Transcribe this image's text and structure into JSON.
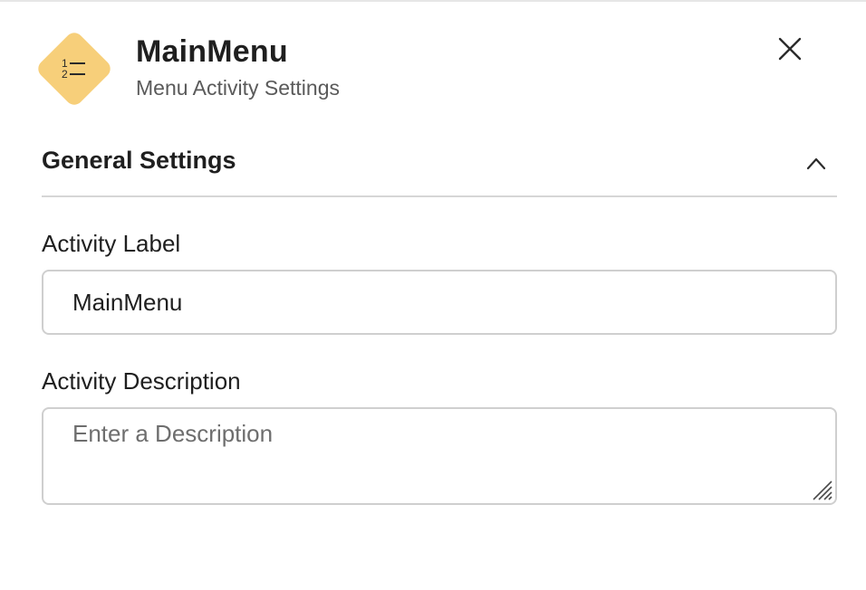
{
  "header": {
    "title": "MainMenu",
    "subtitle": "Menu Activity Settings",
    "icon": "numbered-list-icon",
    "icon_color": "#F7CF7A",
    "icon_glyph": "1— 2—"
  },
  "close": {
    "icon": "close-icon"
  },
  "section": {
    "title": "General Settings",
    "expanded": true,
    "icon": "chevron-up-icon"
  },
  "fields": {
    "activity_label": {
      "label": "Activity Label",
      "value": "MainMenu"
    },
    "activity_description": {
      "label": "Activity Description",
      "value": "",
      "placeholder": "Enter a Description"
    }
  }
}
